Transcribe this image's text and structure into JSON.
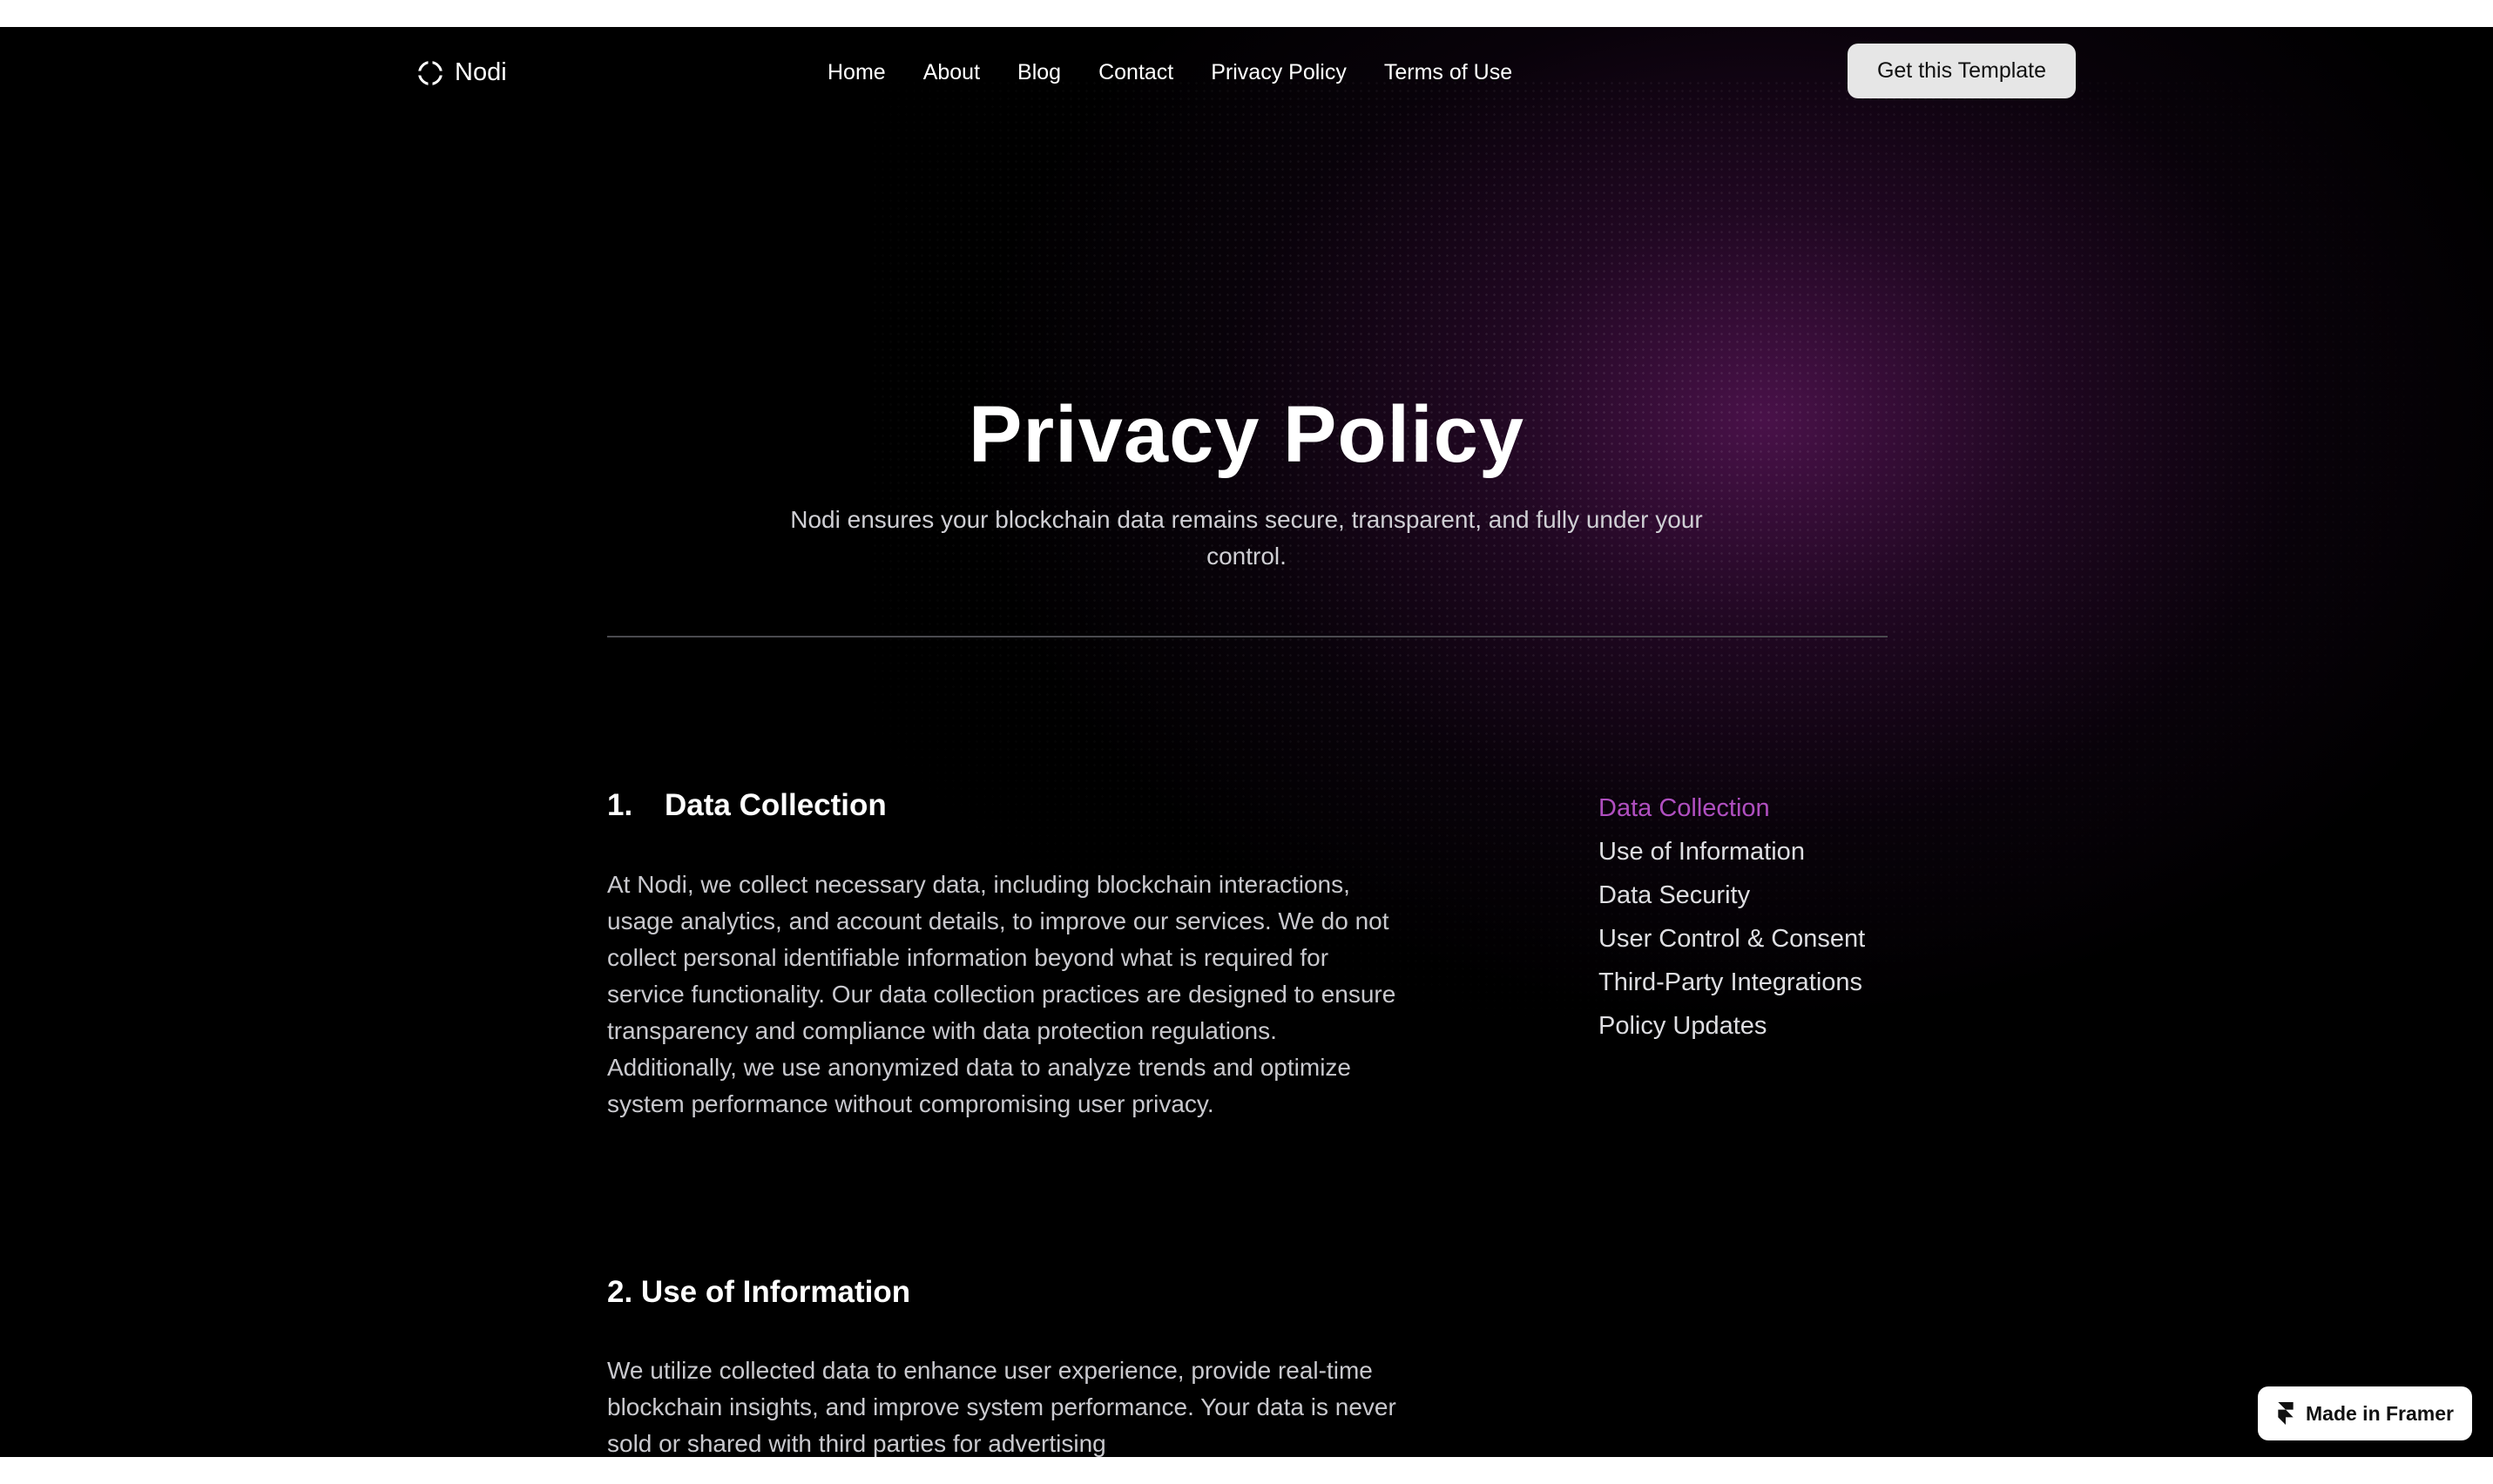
{
  "brand": {
    "name": "Nodi",
    "icon": "nodi-logo-icon"
  },
  "nav": {
    "links": [
      "Home",
      "About",
      "Blog",
      "Contact",
      "Privacy Policy",
      "Terms of Use"
    ],
    "cta_label": "Get this Template"
  },
  "hero": {
    "title": "Privacy Policy",
    "subtitle": "Nodi ensures your blockchain data remains secure, transparent, and fully under your control."
  },
  "sections": [
    {
      "number": "1.",
      "title": "Data Collection",
      "body": "At Nodi, we collect necessary data, including blockchain interactions, usage analytics, and account details, to improve our services. We do not collect personal identifiable information beyond what is required for service functionality. Our data collection practices are designed to ensure transparency and compliance with data protection regulations. Additionally, we use anonymized data to analyze trends and optimize system performance without compromising user privacy."
    },
    {
      "title": "2. Use of Information",
      "body": "We utilize collected data to enhance user experience, provide real-time blockchain insights, and improve system performance. Your data is never sold or shared with third parties for advertising"
    }
  ],
  "toc": {
    "items": [
      "Data Collection",
      "Use of Information",
      "Data Security",
      "User Control & Consent",
      "Third-Party Integrations",
      "Policy Updates"
    ],
    "active_index": 0
  },
  "badge": {
    "label": "Made in Framer",
    "icon": "framer-logo-icon"
  },
  "colors": {
    "background": "#000000",
    "accent": "#b04fc0",
    "glow": "#761c76",
    "cta_bg": "#e6e6e6"
  }
}
